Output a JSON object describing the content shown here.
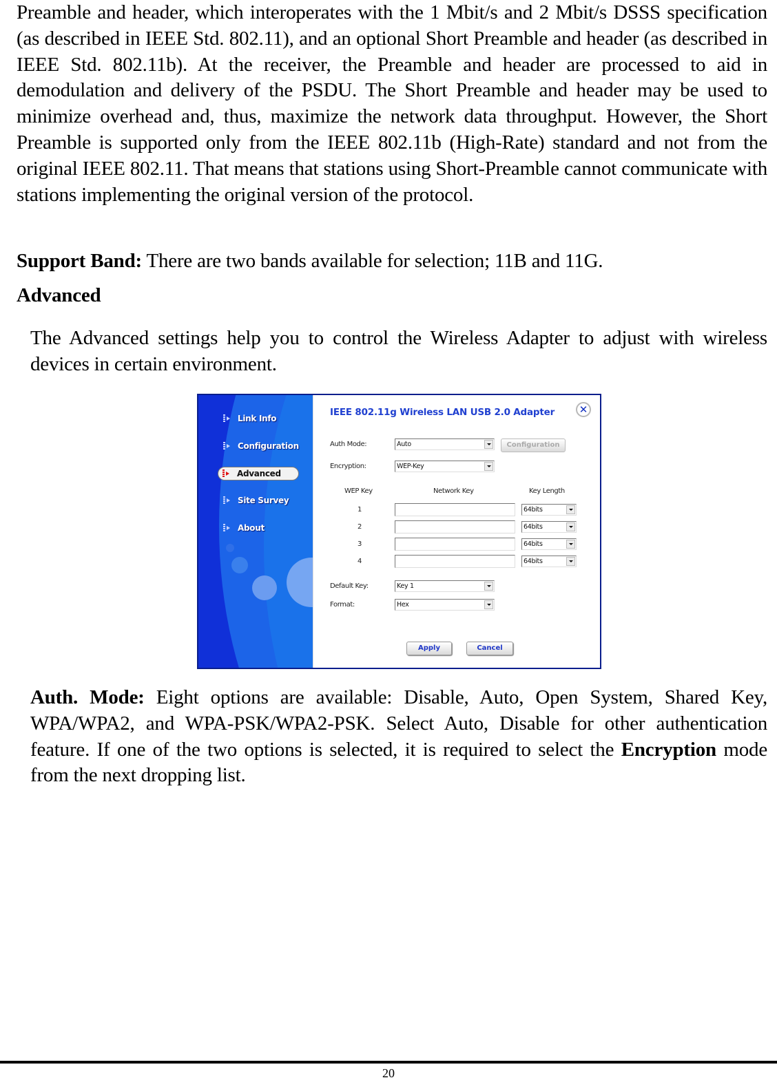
{
  "document": {
    "paragraph_preamble": "Preamble and header, which interoperates with the 1 Mbit/s and 2 Mbit/s DSSS specification (as described in IEEE Std. 802.11), and an optional Short Preamble and header (as described in IEEE Std. 802.11b). At the receiver, the Preamble and header are processed to aid in demodulation and delivery of the PSDU. The Short Preamble and header may be used to minimize overhead and, thus, maximize the network data throughput. However, the Short Preamble is supported only from the IEEE 802.11b (High-Rate) standard and not from the original IEEE 802.11. That means that stations using Short-Preamble cannot communicate with stations implementing the original version of the protocol.",
    "support_band": {
      "term": "Support Band:",
      "text": " There are two bands available for selection; 11B and 11G."
    },
    "advanced_heading": "Advanced",
    "advanced_intro": "The Advanced settings help you to control the Wireless Adapter to adjust with wireless devices in certain environment.",
    "auth_mode": {
      "term": "Auth. Mode:",
      "text_before": " Eight options are available: Disable, Auto, Open System, Shared Key, WPA/WPA2, and WPA-PSK/WPA2-PSK. Select Auto, Disable for other authentication feature.   If one of the two options is selected, it is required to select the ",
      "bold_inline": "Encryption",
      "text_after": " mode from the next dropping list."
    },
    "page_number": "20"
  },
  "dialog": {
    "title": "IEEE 802.11g Wireless LAN USB 2.0 Adapter",
    "close_icon": "close-x-icon",
    "sidebar": {
      "items": [
        {
          "label": "Link Info",
          "active": false
        },
        {
          "label": "Configuration",
          "active": false
        },
        {
          "label": "Advanced",
          "active": true
        },
        {
          "label": "Site Survey",
          "active": false
        },
        {
          "label": "About",
          "active": false
        }
      ]
    },
    "auth_mode": {
      "label": "Auth Mode:",
      "value": "Auto"
    },
    "configuration_button": "Configuration",
    "encryption": {
      "label": "Encryption:",
      "value": "WEP-Key"
    },
    "wep_table": {
      "headers": [
        "WEP Key",
        "Network Key",
        "Key Length"
      ],
      "rows": [
        {
          "index": "1",
          "network_key": "",
          "key_length": "64bits"
        },
        {
          "index": "2",
          "network_key": "",
          "key_length": "64bits"
        },
        {
          "index": "3",
          "network_key": "",
          "key_length": "64bits"
        },
        {
          "index": "4",
          "network_key": "",
          "key_length": "64bits"
        }
      ]
    },
    "default_key": {
      "label": "Default Key:",
      "value": "Key 1"
    },
    "format": {
      "label": "Format:",
      "value": "Hex"
    },
    "apply_button": "Apply",
    "cancel_button": "Cancel",
    "colors": {
      "sidebar_blue": "#1030d8",
      "title_blue": "#2040d0",
      "active_icon_red": "#e01010"
    }
  }
}
